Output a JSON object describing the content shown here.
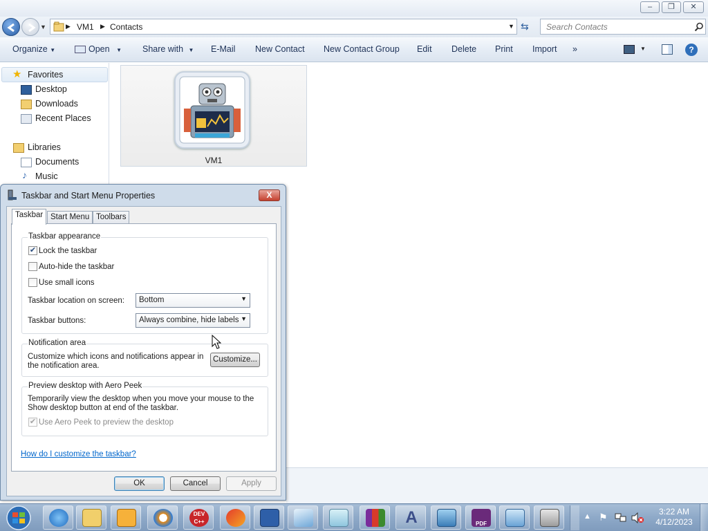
{
  "explorer": {
    "breadcrumb": [
      "VM1",
      "Contacts"
    ],
    "search_placeholder": "Search Contacts",
    "commands": [
      "Organize",
      "Open",
      "Share with",
      "E-Mail",
      "New Contact",
      "New Contact Group",
      "Edit",
      "Delete",
      "Print",
      "Import",
      "»"
    ],
    "nav": {
      "favorites": "Favorites",
      "favorites_items": [
        "Desktop",
        "Downloads",
        "Recent Places"
      ],
      "libraries": "Libraries",
      "libraries_items": [
        "Documents",
        "Music"
      ]
    },
    "items": [
      {
        "label": "VM1"
      }
    ]
  },
  "dialog": {
    "title": "Taskbar and Start Menu Properties",
    "close_label": "X",
    "tabs": [
      "Taskbar",
      "Start Menu",
      "Toolbars"
    ],
    "active_tab": "Taskbar",
    "appearance": {
      "label": "Taskbar appearance",
      "lock": {
        "label": "Lock the taskbar",
        "checked": true
      },
      "autohide": {
        "label": "Auto-hide the taskbar",
        "checked": false
      },
      "small_icons": {
        "label": "Use small icons",
        "checked": false
      },
      "location_label": "Taskbar location on screen:",
      "location_value": "Bottom",
      "buttons_label": "Taskbar buttons:",
      "buttons_value": "Always combine, hide labels"
    },
    "notification": {
      "label": "Notification area",
      "text": "Customize which icons and notifications appear in the notification area.",
      "button": "Customize..."
    },
    "aero": {
      "label": "Preview desktop with Aero Peek",
      "text": "Temporarily view the desktop when you move your mouse to the Show desktop button at end of the taskbar.",
      "checkbox": {
        "label": "Use Aero Peek to preview the desktop",
        "checked": true,
        "disabled": true
      }
    },
    "help_link": "How do I customize the taskbar?",
    "buttons": {
      "ok": "OK",
      "cancel": "Cancel",
      "apply": "Apply"
    }
  },
  "taskbar": {
    "apps": [
      "internet-explorer-icon",
      "file-explorer-icon",
      "media-player-icon",
      "browser-icon",
      "dev-cpp-icon",
      "ccleaner-icon",
      "network-icon",
      "paper-plane-icon",
      "notepad-icon",
      "winrar-icon",
      "font-icon",
      "photo-viewer-icon",
      "pdf-icon",
      "control-panel-icon",
      "computer-icon"
    ],
    "dev_label": "DEV C++",
    "pdf_label": "PDF",
    "clock_time": "3:22 AM",
    "clock_date": "4/12/2023"
  }
}
